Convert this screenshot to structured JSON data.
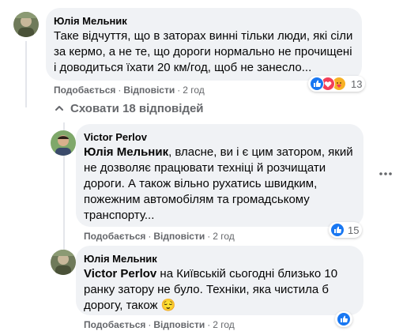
{
  "comments": [
    {
      "author": "Юлія Мельник",
      "lines": [
        "Таке відчуття, що в заторах винні тільки люди, які сіли",
        "за кермо, а не те, що дороги нормально не прочищені",
        "і доводиться їхати 20 км/год, щоб не занесло..."
      ],
      "like_label": "Подобається",
      "reply_label": "Відповісти",
      "time": "2 год",
      "reaction_count": "13"
    },
    {
      "author": "Victor Perlov",
      "mention": "Юлія Мельник",
      "first_line_rest": ", власне, ви і є цим затором, який",
      "lines": [
        "не дозволяє працювати техніці й розчищати",
        "дороги. А також вільно рухатись швидким,",
        "пожежним автомобілям та громадському",
        "транспорту..."
      ],
      "like_label": "Подобається",
      "reply_label": "Відповісти",
      "time": "2 год",
      "reaction_count": "15"
    },
    {
      "author": "Юлія Мельник",
      "mention": "Victor Perlov",
      "first_line_rest": " на Київській сьогодні близько 10",
      "lines": [
        "ранку затору не було. Техніки, яка чистила б",
        "дорогу, також "
      ],
      "emoji": "😌",
      "like_label": "Подобається",
      "reply_label": "Відповісти",
      "time": "2 год"
    }
  ],
  "replies_toggle": "Сховати 18 відповідей",
  "colors": {
    "bubble": "#f0f2f5",
    "meta": "#65676b",
    "like_blue": "#1877f2",
    "love_red": "#f33e58",
    "care_yellow": "#f7b125"
  },
  "icons": [
    "like-icon",
    "love-icon",
    "care-icon",
    "chevron-up-icon",
    "more-options-icon"
  ]
}
